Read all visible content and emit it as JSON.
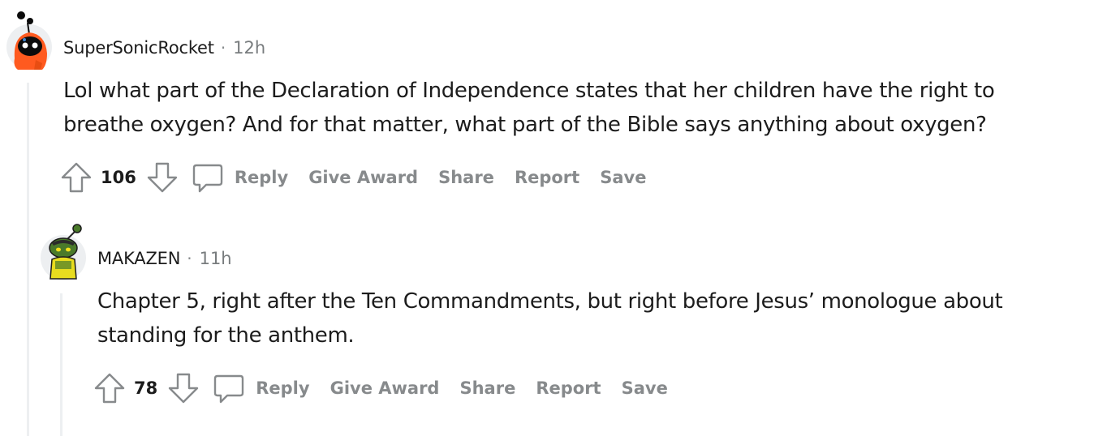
{
  "comments": [
    {
      "username": "SuperSonicRocket",
      "separator": "·",
      "time": "12h",
      "body_line1": "Lol what part of the Declaration of Independence states that her children have the right to",
      "body_line2": "breathe oxygen? And for that matter, what part of the Bible says anything about oxygen?",
      "score": "106",
      "actions": {
        "reply": "Reply",
        "award": "Give Award",
        "share": "Share",
        "report": "Report",
        "save": "Save"
      },
      "avatar_colors": {
        "hood": "#ff5a1f",
        "face": "#0b0b0b",
        "eyes": "#ffffff"
      }
    },
    {
      "username": "MAKAZEN",
      "separator": "·",
      "time": "11h",
      "body_line1": "Chapter 5, right after the Ten Commandments, but right before Jesus’ monologue about",
      "body_line2": "standing for the anthem.",
      "score": "78",
      "actions": {
        "reply": "Reply",
        "award": "Give Award",
        "share": "Share",
        "report": "Report",
        "save": "Save"
      },
      "avatar_colors": {
        "head": "#4a7a2a",
        "shirt": "#e8dc1f",
        "eyes": "#f5e11a"
      }
    }
  ],
  "icons": {
    "upvote": "upvote-arrow-icon",
    "downvote": "downvote-arrow-icon",
    "reply": "speech-bubble-icon"
  },
  "colors": {
    "text": "#1c1c1c",
    "meta": "#787c7e",
    "action": "#878a8c",
    "thread_line": "#edeff1"
  }
}
